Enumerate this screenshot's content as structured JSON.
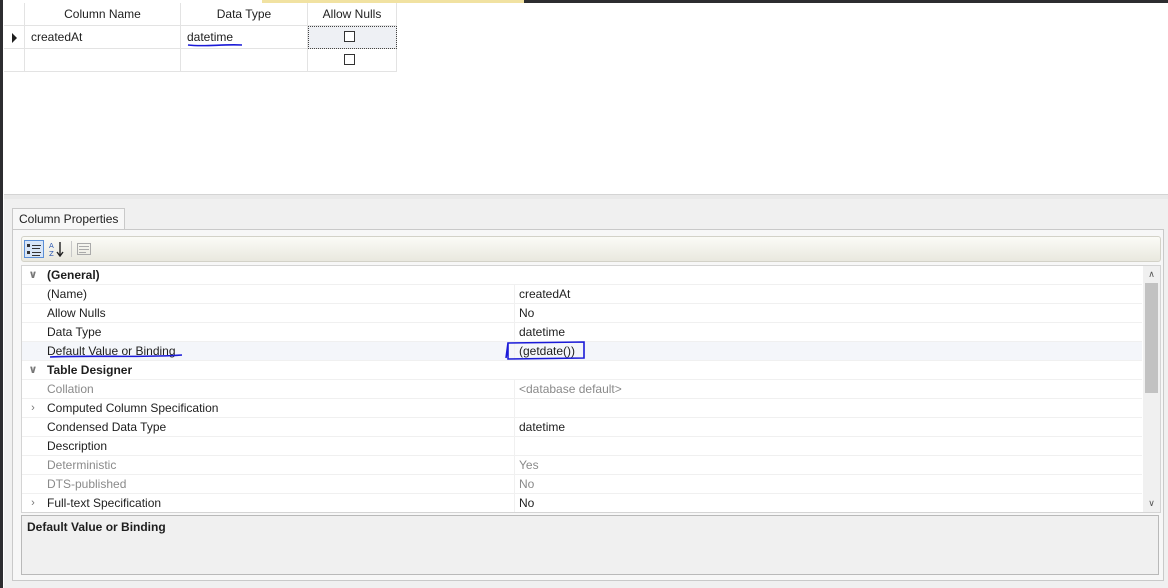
{
  "table_designer": {
    "headers": {
      "column_name": "Column Name",
      "data_type": "Data Type",
      "allow_nulls": "Allow Nulls"
    },
    "rows": [
      {
        "column_name": "createdAt",
        "data_type": "datetime",
        "allow_nulls": false,
        "current": true
      },
      {
        "column_name": "",
        "data_type": "",
        "allow_nulls": false,
        "current": false
      }
    ]
  },
  "properties_panel": {
    "tab_label": "Column Properties",
    "toolbar": {
      "categorized_icon": "categorized-icon",
      "alphabetical_icon": "alphabetical-sort-icon",
      "property_pages_icon": "property-pages-icon"
    },
    "categories": [
      {
        "label": "(General)",
        "expanded": true,
        "items": [
          {
            "name": "(Name)",
            "value": "createdAt"
          },
          {
            "name": "Allow Nulls",
            "value": "No"
          },
          {
            "name": "Data Type",
            "value": "datetime"
          },
          {
            "name": "Default Value or Binding",
            "value": "(getdate())",
            "selected": true
          }
        ]
      },
      {
        "label": "Table Designer",
        "expanded": true,
        "items": [
          {
            "name": "Collation",
            "value": "<database default>",
            "dim": true
          },
          {
            "name": "Computed Column Specification",
            "value": "",
            "expandable": true
          },
          {
            "name": "Condensed Data Type",
            "value": "datetime"
          },
          {
            "name": "Description",
            "value": ""
          },
          {
            "name": "Deterministic",
            "value": "Yes",
            "dim": true
          },
          {
            "name": "DTS-published",
            "value": "No",
            "dim": true
          },
          {
            "name": "Full-text Specification",
            "value": "No",
            "expandable": true
          }
        ]
      }
    ],
    "description_title": "Default Value or Binding"
  },
  "annotation_colors": {
    "pen": "#1a1ad8"
  }
}
